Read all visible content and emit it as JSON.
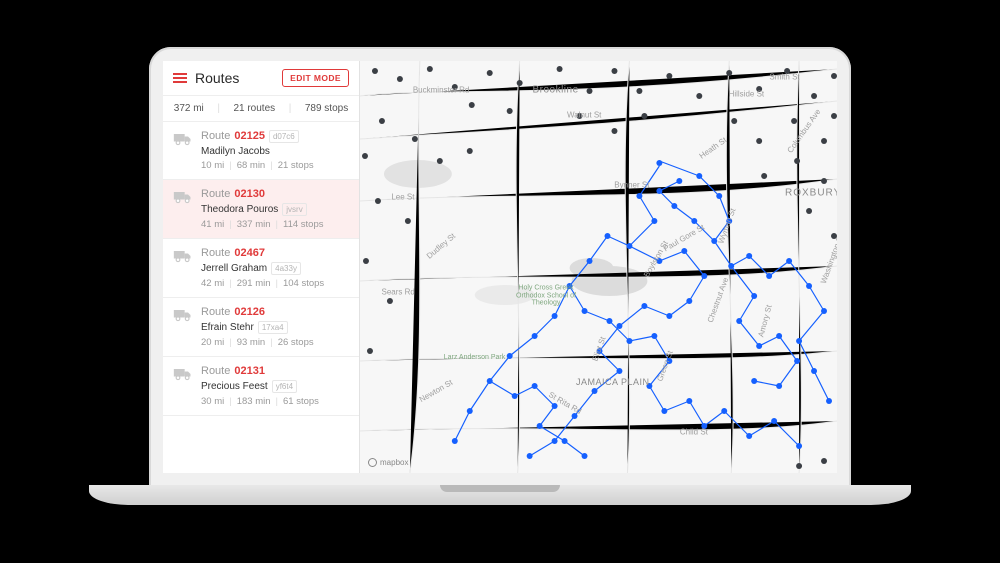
{
  "header": {
    "title": "Routes",
    "edit_button": "EDIT MODE"
  },
  "summary": {
    "distance": "372 mi",
    "routes": "21 routes",
    "stops": "789 stops"
  },
  "routes": [
    {
      "prefix": "Route",
      "code": "02125",
      "tag": "d07c6",
      "driver": "Madilyn Jacobs",
      "dist": "10 mi",
      "time": "68 min",
      "stops": "21 stops",
      "selected": false
    },
    {
      "prefix": "Route",
      "code": "02130",
      "tag": "jvsrv",
      "driver": "Theodora Pouros",
      "dist": "41 mi",
      "time": "337 min",
      "stops": "114 stops",
      "selected": true
    },
    {
      "prefix": "Route",
      "code": "02467",
      "tag": "4a33y",
      "driver": "Jerrell Graham",
      "dist": "42 mi",
      "time": "291 min",
      "stops": "104 stops",
      "selected": false
    },
    {
      "prefix": "Route",
      "code": "02126",
      "tag": "17xa4",
      "driver": "Efrain Stehr",
      "dist": "20 mi",
      "time": "93 min",
      "stops": "26 stops",
      "selected": false
    },
    {
      "prefix": "Route",
      "code": "02131",
      "tag": "yf6t4",
      "driver": "Precious Feest",
      "dist": "30 mi",
      "time": "183 min",
      "stops": "61 stops",
      "selected": false
    }
  ],
  "map": {
    "attribution": "mapbox",
    "place_labels": {
      "brookline": "Brookline",
      "roxbury": "ROXBURY",
      "jamaica_plain": "JAMAICA PLAIN",
      "buckminster": "Buckminster Rd",
      "walnut": "Walnut St",
      "hillside": "Hillside St",
      "columbus": "Columbus Ave",
      "washington": "Washington St",
      "lee": "Lee St",
      "dudley": "Dudley St",
      "sears": "Sears Rd",
      "heath": "Heath St",
      "bynner": "Bynner St",
      "paul_gore": "Paul Gore St",
      "boylston": "Boylston St",
      "wyman": "Wyman St",
      "chestnut": "Chestnut Ave",
      "amory": "Amory St",
      "larz": "Larz Anderson Park",
      "holy_cross": "Holy Cross Greek Orthodox School of Theology",
      "newton": "Newton St",
      "rita": "St Rita Rd",
      "eliot": "Eliot St",
      "green": "Green St",
      "child": "Child St",
      "smith": "Smith St"
    }
  }
}
